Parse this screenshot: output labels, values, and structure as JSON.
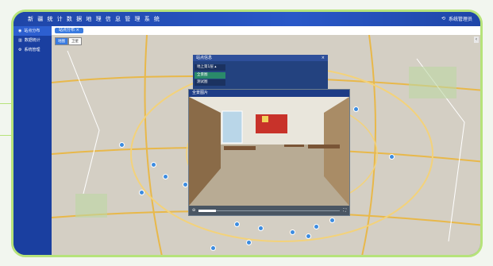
{
  "app": {
    "title": "新 疆 统 计 数 据 地 理 信 息 管 理 系 统",
    "user_label": "系统管理员"
  },
  "sidebar": {
    "items": [
      {
        "label": "站点分布",
        "icon": "map-pin-icon"
      },
      {
        "label": "数据统计",
        "icon": "chart-icon"
      },
      {
        "label": "系统管理",
        "icon": "gear-icon"
      }
    ]
  },
  "tabs": [
    {
      "label": "站点分布"
    }
  ],
  "map": {
    "toggle": [
      "地图",
      "卫星"
    ]
  },
  "site_info": {
    "title": "站点信息",
    "floor_select": "地上第1层",
    "options": [
      "全景图",
      "测试图"
    ]
  },
  "panorama": {
    "title": "全景图片"
  },
  "colors": {
    "accent": "#2958c8",
    "frame": "#b6e37a",
    "marker": "#3c8ce0"
  }
}
